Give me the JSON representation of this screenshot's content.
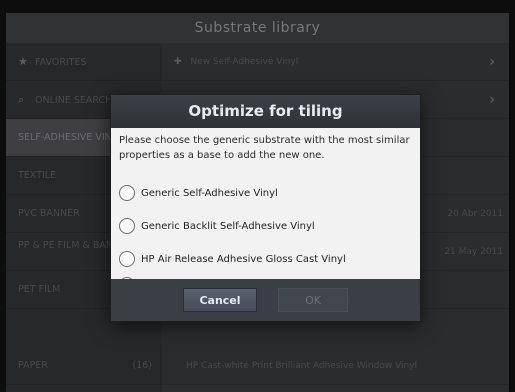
{
  "window": {
    "title": "Substrate library"
  },
  "sidebar": {
    "items": [
      {
        "icon": "star-icon",
        "label": "FAVORITES",
        "count": "",
        "active": false
      },
      {
        "icon": "search-icon",
        "label": "ONLINE SEARCH",
        "count": "",
        "active": false
      },
      {
        "icon": "",
        "label": "SELF-ADHESIVE VINYL",
        "count": "",
        "active": true
      },
      {
        "icon": "",
        "label": "TEXTILE",
        "count": "",
        "active": false
      },
      {
        "icon": "",
        "label": "PVC BANNER",
        "count": "",
        "active": false
      },
      {
        "icon": "",
        "label": "PP & PE FILM & BANNER",
        "count": "",
        "active": false
      },
      {
        "icon": "",
        "label": "PET FILM",
        "count": "",
        "active": false
      },
      {
        "icon": "",
        "label": "PAPER",
        "count": "(16)",
        "active": false
      }
    ]
  },
  "main": {
    "rows": [
      {
        "label": "New Self-Adhesive Vinyl",
        "trail": "›"
      },
      {
        "label": "",
        "trail": "›"
      },
      {
        "label": "",
        "trail": ""
      },
      {
        "label": "",
        "trail": ""
      },
      {
        "label": "",
        "trail": "20 Abr 2011"
      },
      {
        "label": "",
        "trail": "21 May 2011"
      },
      {
        "label": "",
        "trail": ""
      },
      {
        "label": "HP Cast-white Print Brilliant Adhesive Window Vinyl",
        "trail": ""
      }
    ]
  },
  "dialog": {
    "title": "Optimize for tiling",
    "message": "Please choose the generic substrate with the most similar properties as a base to add the new one.",
    "options": [
      "Generic Self-Adhesive Vinyl",
      "Generic Backlit Self-Adhesive Vinyl",
      "HP Air Release Adhesive Gloss Cast Vinyl"
    ],
    "cancel_label": "Cancel",
    "ok_label": "OK"
  }
}
